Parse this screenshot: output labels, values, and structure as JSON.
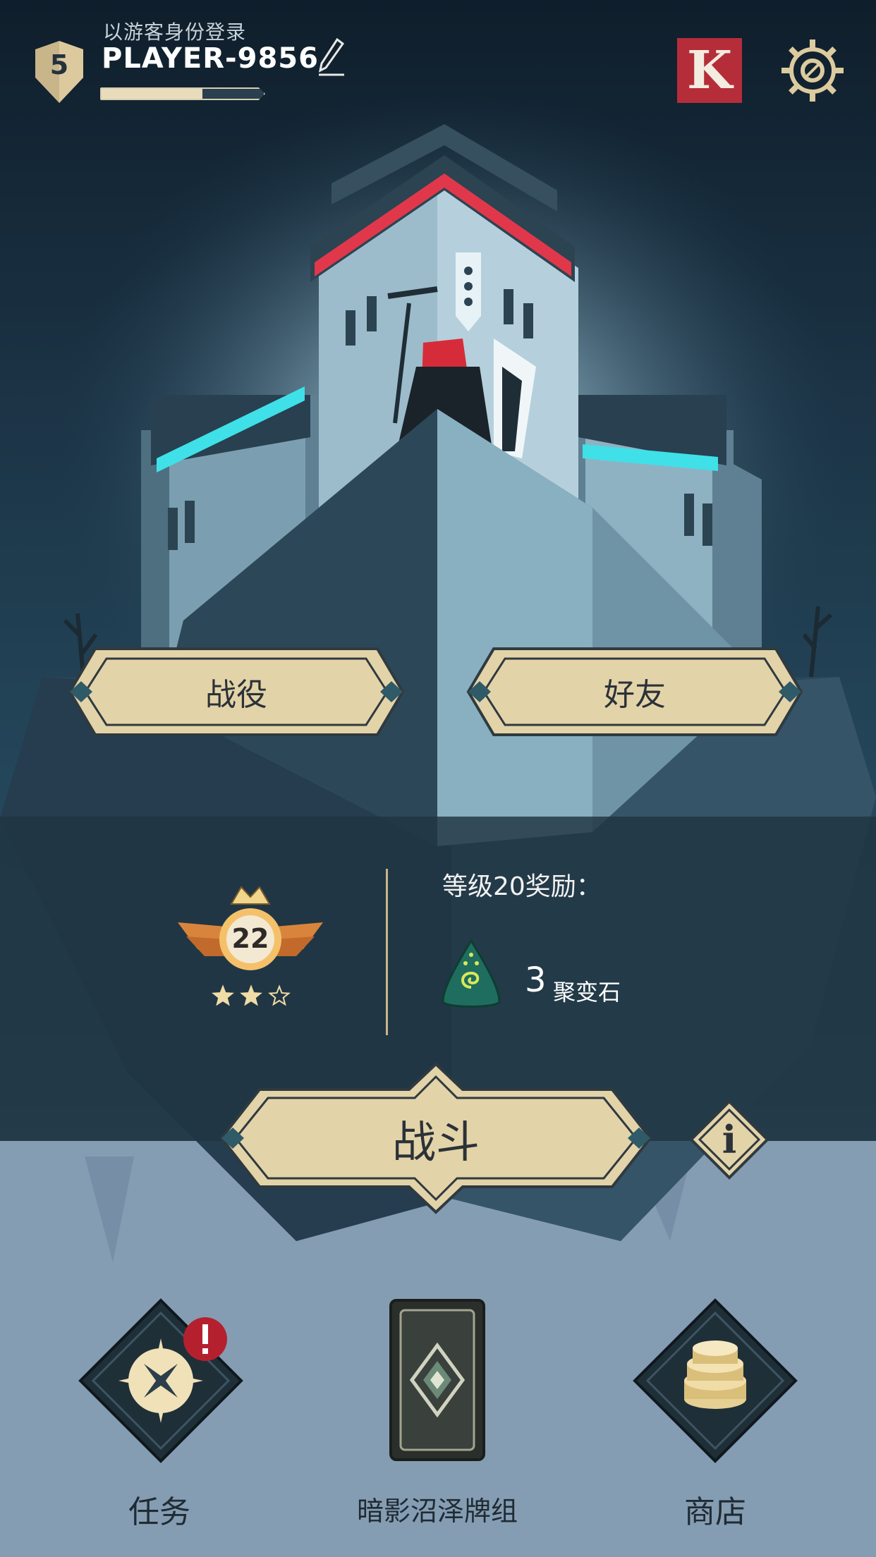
{
  "header": {
    "player_level": "5",
    "guest_label": "以游客身份登录",
    "player_name": "PLAYER-9856",
    "xp_progress": 0.62,
    "kong_label": "K",
    "edit_icon": "pencil-icon",
    "settings_icon": "gear-icon"
  },
  "menu": {
    "campaign_label": "战役",
    "friends_label": "好友"
  },
  "rank": {
    "level": "22",
    "stars_filled": 2,
    "stars_total": 3
  },
  "reward": {
    "title": "等级20奖励：",
    "quantity": "3",
    "item_name": "聚变石",
    "item_icon": "fusion-stone-icon"
  },
  "battle": {
    "label": "战斗",
    "info_label": "i"
  },
  "nav": {
    "quests_label": "任务",
    "quests_alert": "!",
    "deck_label": "暗影沼泽牌组",
    "shop_label": "商店"
  },
  "colors": {
    "sky_top": "#0f1e2b",
    "sky_mid": "#24465a",
    "ground_bottom": "#8ea6bc",
    "button_fill": "#e3d3a8",
    "button_border": "#2f3a40",
    "accent_red": "#e0384a",
    "accent_cyan": "#3fe0e8",
    "kong_red": "#b62d3a",
    "alert_red": "#b5202f"
  }
}
